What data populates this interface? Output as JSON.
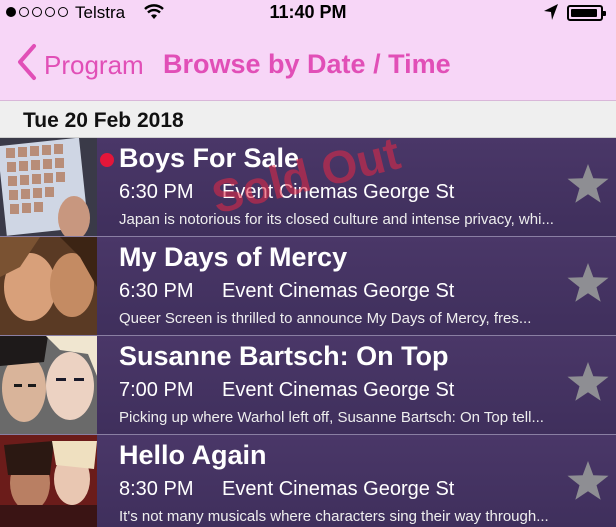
{
  "status_bar": {
    "carrier": "Telstra",
    "time": "11:40 PM",
    "signal_icon": "signal-dots-icon",
    "wifi_icon": "wifi-icon",
    "location_icon": "location-arrow-icon",
    "battery_icon": "battery-icon"
  },
  "nav": {
    "back_label": "Program",
    "title": "Browse by Date / Time",
    "accent_color": "#e14fb7"
  },
  "section": {
    "date": "Tue 20 Feb 2018"
  },
  "events": [
    {
      "title": "Boys For Sale",
      "time": "6:30 PM",
      "venue": "Event Cinemas George St",
      "description": "Japan is notorious for its closed culture and intense privacy, whi...",
      "sold_out_label": "Sold Out",
      "has_indicator": true
    },
    {
      "title": "My Days of Mercy",
      "time": "6:30 PM",
      "venue": "Event Cinemas George St",
      "description": "Queer Screen is thrilled to announce  My   Days of Mercy,  fres..."
    },
    {
      "title": "Susanne Bartsch: On Top",
      "time": "7:00 PM",
      "venue": "Event Cinemas George St",
      "description": "Picking up where Warhol left off,  Susanne Bartsch: On Top  tell..."
    },
    {
      "title": "Hello Again",
      "time": "8:30 PM",
      "venue": "Event Cinemas George St",
      "description": "It's not many musicals where characters sing their way through..."
    }
  ]
}
